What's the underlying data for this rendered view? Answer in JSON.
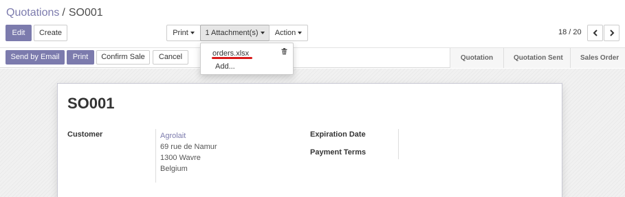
{
  "breadcrumb": {
    "parent": "Quotations",
    "separator": "/",
    "current": "SO001"
  },
  "toolbar": {
    "edit_label": "Edit",
    "create_label": "Create",
    "print_label": "Print",
    "attachments_label": "1 Attachment(s)",
    "action_label": "Action"
  },
  "pager": {
    "value": "18 / 20"
  },
  "attachments_menu": {
    "items": [
      {
        "label": "orders.xlsx"
      },
      {
        "label": "Add..."
      }
    ]
  },
  "statusbar": {
    "buttons": {
      "send_email": "Send by Email",
      "print": "Print",
      "confirm": "Confirm Sale",
      "cancel": "Cancel"
    },
    "stages": [
      "Quotation",
      "Quotation Sent",
      "Sales Order"
    ]
  },
  "sheet": {
    "title": "SO001",
    "customer_label": "Customer",
    "customer": {
      "name": "Agrolait",
      "address_line1": "69 rue de Namur",
      "address_line2": "1300 Wavre",
      "country": "Belgium"
    },
    "expiration_label": "Expiration Date",
    "payment_terms_label": "Payment Terms"
  },
  "colors": {
    "primary": "#7c7bad",
    "underline": "#d81b1b"
  }
}
